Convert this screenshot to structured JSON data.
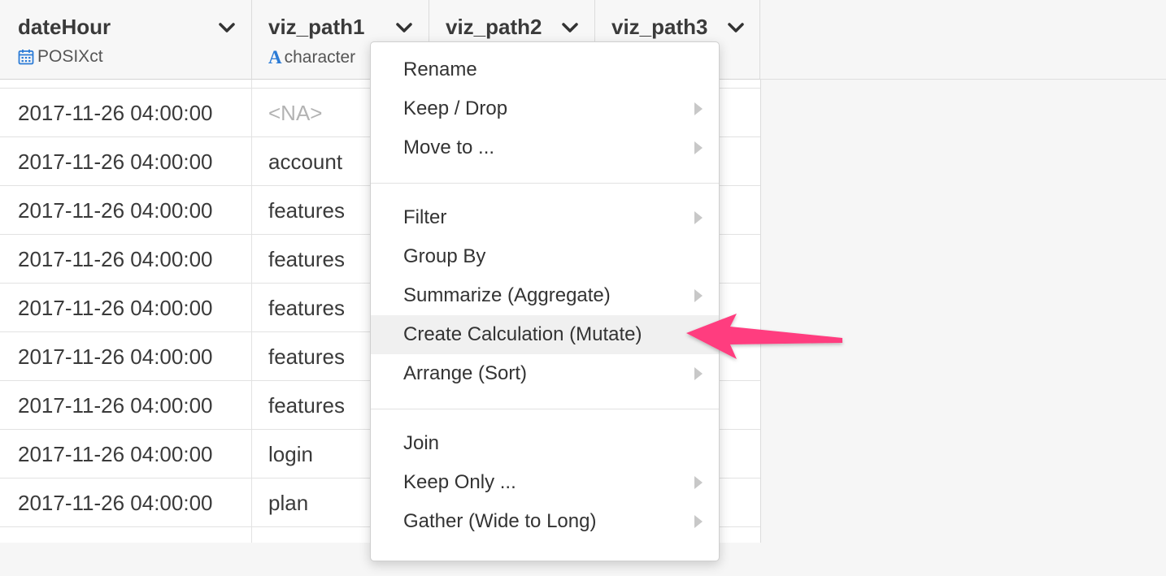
{
  "columns": [
    {
      "name": "dateHour",
      "type": "POSIXct",
      "type_icon": "calendar-icon"
    },
    {
      "name": "viz_path1",
      "type": "character",
      "type_icon": "character-type-icon"
    },
    {
      "name": "viz_path2",
      "type": "",
      "type_icon": "chevron-down-icon"
    },
    {
      "name": "viz_path3",
      "type": "",
      "type_icon": "chevron-down-icon"
    }
  ],
  "type_icon_letter": "A",
  "rows": [
    {
      "dateHour": "2017-11-26 04:00:00",
      "viz_path1": "<NA>"
    },
    {
      "dateHour": "2017-11-26 04:00:00",
      "viz_path1": "account"
    },
    {
      "dateHour": "2017-11-26 04:00:00",
      "viz_path1": "features"
    },
    {
      "dateHour": "2017-11-26 04:00:00",
      "viz_path1": "features"
    },
    {
      "dateHour": "2017-11-26 04:00:00",
      "viz_path1": "features"
    },
    {
      "dateHour": "2017-11-26 04:00:00",
      "viz_path1": "features"
    },
    {
      "dateHour": "2017-11-26 04:00:00",
      "viz_path1": "features"
    },
    {
      "dateHour": "2017-11-26 04:00:00",
      "viz_path1": "login"
    },
    {
      "dateHour": "2017-11-26 04:00:00",
      "viz_path1": "plan"
    }
  ],
  "menu": {
    "groups": [
      [
        {
          "label": "Rename",
          "submenu": false
        },
        {
          "label": "Keep / Drop",
          "submenu": true
        },
        {
          "label": "Move to ...",
          "submenu": true
        }
      ],
      [
        {
          "label": "Filter",
          "submenu": true
        },
        {
          "label": "Group By",
          "submenu": false
        },
        {
          "label": "Summarize (Aggregate)",
          "submenu": true
        },
        {
          "label": "Create Calculation (Mutate)",
          "submenu": false,
          "highlighted": true
        },
        {
          "label": "Arrange (Sort)",
          "submenu": true
        }
      ],
      [
        {
          "label": "Join",
          "submenu": false
        },
        {
          "label": "Keep Only ...",
          "submenu": true
        },
        {
          "label": "Gather (Wide to Long)",
          "submenu": true
        }
      ]
    ]
  },
  "colors": {
    "accent_arrow": "#ff3d7f",
    "type_icon": "#2b7bd6",
    "na_text": "#b3b3b3"
  }
}
